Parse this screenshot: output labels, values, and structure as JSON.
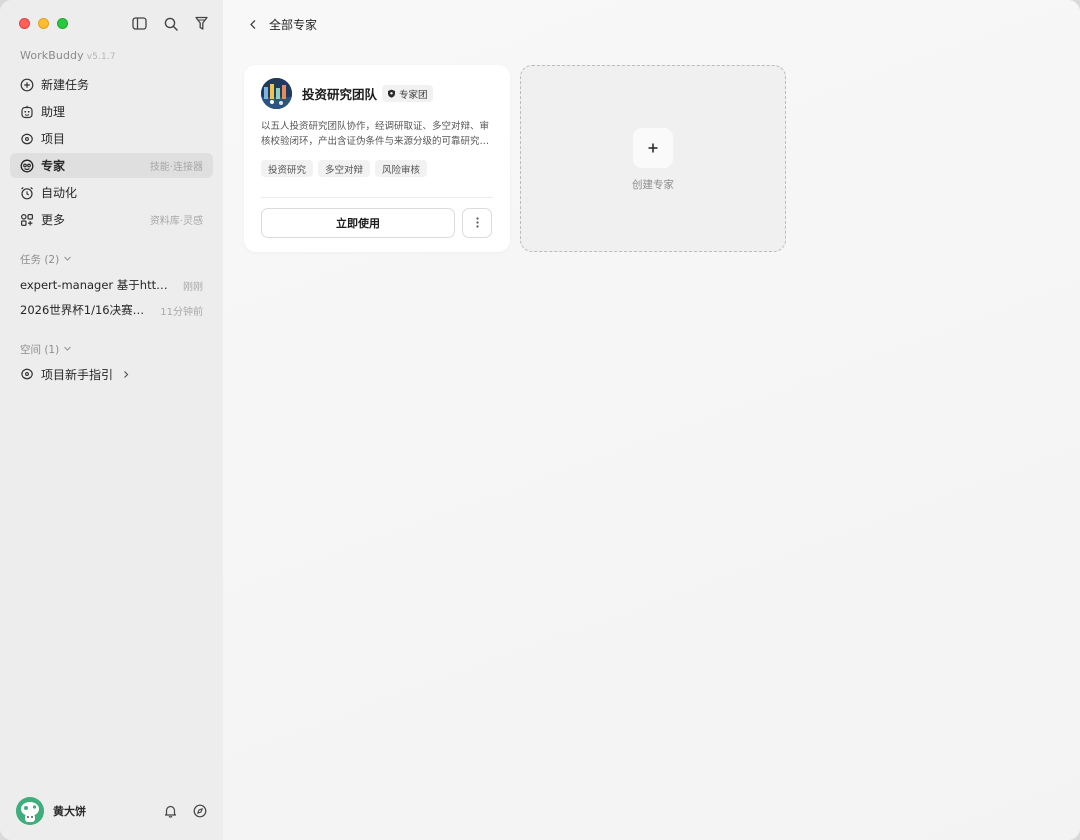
{
  "app": {
    "name": "WorkBuddy",
    "version": "v5.1.7"
  },
  "nav": {
    "items": [
      {
        "label": "新建任务",
        "icon": "plus-circle-icon",
        "hint": ""
      },
      {
        "label": "助理",
        "icon": "robot-icon",
        "hint": ""
      },
      {
        "label": "项目",
        "icon": "project-icon",
        "hint": ""
      },
      {
        "label": "专家",
        "icon": "expert-icon",
        "hint": "技能·连接器",
        "active": true
      },
      {
        "label": "自动化",
        "icon": "alarm-clock-icon",
        "hint": ""
      },
      {
        "label": "更多",
        "icon": "grid-icon",
        "hint": "资料库·灵感"
      }
    ]
  },
  "tasks": {
    "title": "任务 (2)",
    "items": [
      {
        "name": "expert-manager 基于https://...",
        "time": "刚刚"
      },
      {
        "name": "2026世界杯1/16决赛预测",
        "time": "11分钟前"
      }
    ]
  },
  "spaces": {
    "title": "空间 (1)",
    "items": [
      {
        "name": "项目新手指引"
      }
    ]
  },
  "user": {
    "name": "黄大饼"
  },
  "breadcrumb": {
    "label": "全部专家"
  },
  "expert_card": {
    "title": "投资研究团队",
    "badge": "专家团",
    "description": "以五人投资研究团队协作，经调研取证、多空对辩、审核校验闭环，产出含证伪条件与来源分级的可靠研究结...",
    "tags": [
      "投资研究",
      "多空对辩",
      "风险审核"
    ],
    "use_button": "立即使用"
  },
  "create_card": {
    "label": "创建专家",
    "plus": "+"
  }
}
